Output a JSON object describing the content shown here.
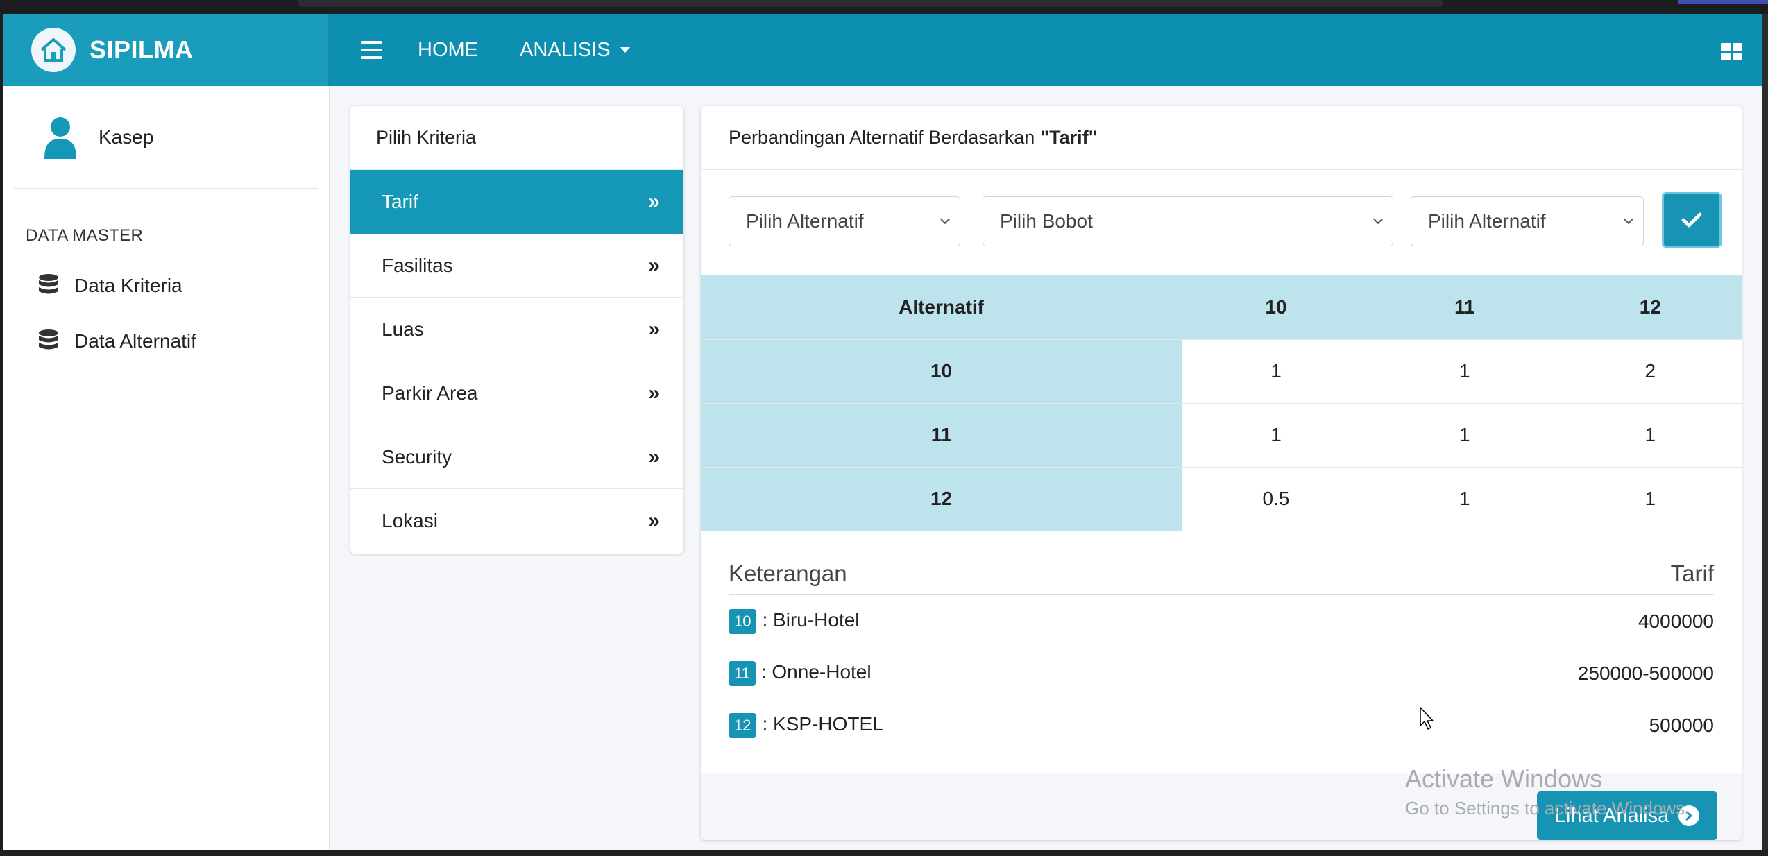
{
  "brand": {
    "name": "SIPILMA"
  },
  "navbar": {
    "links": [
      {
        "label": "HOME"
      },
      {
        "label": "ANALISIS"
      }
    ]
  },
  "sidebar": {
    "user": "Kasep",
    "section_header": "DATA MASTER",
    "items": [
      {
        "label": "Data Kriteria"
      },
      {
        "label": "Data Alternatif"
      }
    ]
  },
  "criteria": {
    "title": "Pilih Kriteria",
    "items": [
      {
        "label": "Tarif",
        "active": true
      },
      {
        "label": "Fasilitas"
      },
      {
        "label": "Luas"
      },
      {
        "label": "Parkir Area"
      },
      {
        "label": "Security"
      },
      {
        "label": "Lokasi"
      }
    ],
    "chevron": "»"
  },
  "comparison": {
    "title_prefix": "Perbandingan Alternatif Berdasarkan",
    "title_criteria": "\"Tarif\"",
    "select_alt1": "Pilih Alternatif",
    "select_weight": "Pilih Bobot",
    "select_alt2": "Pilih Alternatif",
    "matrix": {
      "header": [
        "Alternatif",
        "10",
        "11",
        "12"
      ],
      "rows": [
        {
          "label": "10",
          "values": [
            "1",
            "1",
            "2"
          ]
        },
        {
          "label": "11",
          "values": [
            "1",
            "1",
            "1"
          ]
        },
        {
          "label": "12",
          "values": [
            "0.5",
            "1",
            "1"
          ]
        }
      ]
    },
    "keterangan": {
      "header_left": "Keterangan",
      "header_right": "Tarif",
      "rows": [
        {
          "id": "10",
          "name": ": Biru-Hotel",
          "value": "4000000"
        },
        {
          "id": "11",
          "name": ": Onne-Hotel",
          "value": "250000-500000"
        },
        {
          "id": "12",
          "name": ": KSP-HOTEL",
          "value": "500000"
        }
      ]
    },
    "button_label": "Lihat Analisa"
  },
  "watermark": {
    "line1": "Activate Windows",
    "line2": "Go to Settings to activate Windows."
  },
  "colors": {
    "primary": "#0d8fb2",
    "brand": "#1a9cbc",
    "table_header": "#bde3ec",
    "badge": "#1793b4"
  }
}
